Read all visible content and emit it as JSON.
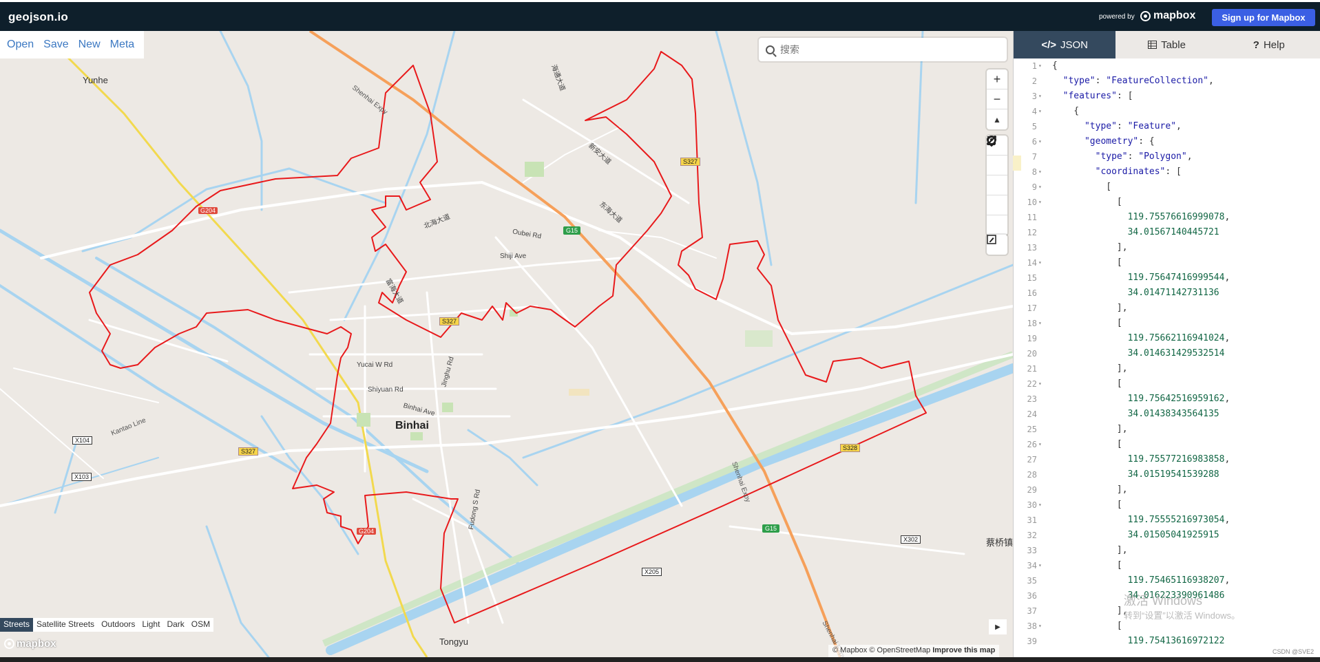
{
  "app": {
    "brand": "geojson.io",
    "powered_by": "powered by",
    "mapbox_logo": "mapbox",
    "signup_label": "Sign up for Mapbox"
  },
  "menu": [
    "Open",
    "Save",
    "New",
    "Meta"
  ],
  "search": {
    "placeholder": "搜索",
    "icon": "search-icon"
  },
  "map_controls": {
    "zoom": [
      "+",
      "−",
      "▲"
    ],
    "draw": [
      "marker-icon",
      "line-icon",
      "polygon-icon",
      "rectangle-icon",
      "circle-icon"
    ],
    "edit": "edit-icon"
  },
  "styles": [
    "Streets",
    "Satellite Streets",
    "Outdoors",
    "Light",
    "Dark",
    "OSM"
  ],
  "active_style": "Streets",
  "attribution": {
    "mapbox": "© Mapbox",
    "osm": "© OpenStreetMap",
    "improve": "Improve this map"
  },
  "map_labels": {
    "yunhe": "Yunhe",
    "binhai": "Binhai",
    "tongyu": "Tongyu",
    "caiqiao": "蔡桥镇",
    "shenhai1": "Shenhai Expy",
    "shenhai2": "Shenhai Expy",
    "shenhai3": "Shenhai Expy",
    "kantao": "Kantao Line",
    "yucai": "Yucai W Rd",
    "shiyuan": "Shiyuan Rd",
    "binhai_ave": "Binhai Ave",
    "jinghu": "Jinghu Rd",
    "fudong": "Fudong S Rd",
    "oubei": "Oubei Rd",
    "shiji": "Shiji Ave",
    "beihai": "北海大道",
    "xinan": "新安大道",
    "donghai": "东海大道",
    "haitong": "海通大道",
    "fuhai": "富海大道",
    "g204a": "G204",
    "g204b": "G204",
    "g15a": "G15",
    "g15b": "G15",
    "s327a": "S327",
    "s327b": "S327",
    "s327c": "S327",
    "s328": "S328",
    "x104": "X104",
    "x103": "X103",
    "x302": "X302",
    "x205": "X205"
  },
  "tabs": [
    {
      "label": "JSON",
      "icon": "code-icon",
      "active": true
    },
    {
      "label": "Table",
      "icon": "table-icon",
      "active": false
    },
    {
      "label": "Help",
      "icon": "help-icon",
      "active": false
    }
  ],
  "code_lines": [
    {
      "n": "1",
      "fold": true,
      "text": "{"
    },
    {
      "n": "2",
      "fold": false,
      "text": "  \"type\": \"FeatureCollection\","
    },
    {
      "n": "3",
      "fold": true,
      "text": "  \"features\": ["
    },
    {
      "n": "4",
      "fold": true,
      "text": "    {"
    },
    {
      "n": "5",
      "fold": false,
      "text": "      \"type\": \"Feature\","
    },
    {
      "n": "6",
      "fold": true,
      "text": "      \"geometry\": {"
    },
    {
      "n": "7",
      "fold": false,
      "text": "        \"type\": \"Polygon\","
    },
    {
      "n": "8",
      "fold": true,
      "text": "        \"coordinates\": ["
    },
    {
      "n": "9",
      "fold": true,
      "text": "          ["
    },
    {
      "n": "10",
      "fold": true,
      "text": "            ["
    },
    {
      "n": "11",
      "fold": false,
      "text": "              119.75576616999078,"
    },
    {
      "n": "12",
      "fold": false,
      "text": "              34.01567140445721"
    },
    {
      "n": "13",
      "fold": false,
      "text": "            ],"
    },
    {
      "n": "14",
      "fold": true,
      "text": "            ["
    },
    {
      "n": "15",
      "fold": false,
      "text": "              119.75647416999544,"
    },
    {
      "n": "16",
      "fold": false,
      "text": "              34.01471142731136"
    },
    {
      "n": "17",
      "fold": false,
      "text": "            ],"
    },
    {
      "n": "18",
      "fold": true,
      "text": "            ["
    },
    {
      "n": "19",
      "fold": false,
      "text": "              119.75662116941024,"
    },
    {
      "n": "20",
      "fold": false,
      "text": "              34.014631429532514"
    },
    {
      "n": "21",
      "fold": false,
      "text": "            ],"
    },
    {
      "n": "22",
      "fold": true,
      "text": "            ["
    },
    {
      "n": "23",
      "fold": false,
      "text": "              119.75642516959162,"
    },
    {
      "n": "24",
      "fold": false,
      "text": "              34.01438343564135"
    },
    {
      "n": "25",
      "fold": false,
      "text": "            ],"
    },
    {
      "n": "26",
      "fold": true,
      "text": "            ["
    },
    {
      "n": "27",
      "fold": false,
      "text": "              119.75577216983858,"
    },
    {
      "n": "28",
      "fold": false,
      "text": "              34.01519541539288"
    },
    {
      "n": "29",
      "fold": false,
      "text": "            ],"
    },
    {
      "n": "30",
      "fold": true,
      "text": "            ["
    },
    {
      "n": "31",
      "fold": false,
      "text": "              119.75555216973054,"
    },
    {
      "n": "32",
      "fold": false,
      "text": "              34.01505041925915"
    },
    {
      "n": "33",
      "fold": false,
      "text": "            ],"
    },
    {
      "n": "34",
      "fold": true,
      "text": "            ["
    },
    {
      "n": "35",
      "fold": false,
      "text": "              119.75465116938207,"
    },
    {
      "n": "36",
      "fold": false,
      "text": "              34.016223390961486"
    },
    {
      "n": "37",
      "fold": false,
      "text": "            ],"
    },
    {
      "n": "38",
      "fold": true,
      "text": "            ["
    },
    {
      "n": "39",
      "fold": false,
      "text": "              119.75413616972122"
    }
  ],
  "overlay": {
    "windows_activate": "激活 Windows",
    "windows_sub": "转到“设置”以激活 Windows。",
    "csdn": "CSDN @SVE2"
  },
  "colors": {
    "boundary": "#e8191b",
    "expressway": "#f6a05a",
    "trunk": "#f2d94e",
    "water": "#a8d4f0",
    "topbar": "#0e1f2b",
    "active_tab": "#34495e"
  }
}
